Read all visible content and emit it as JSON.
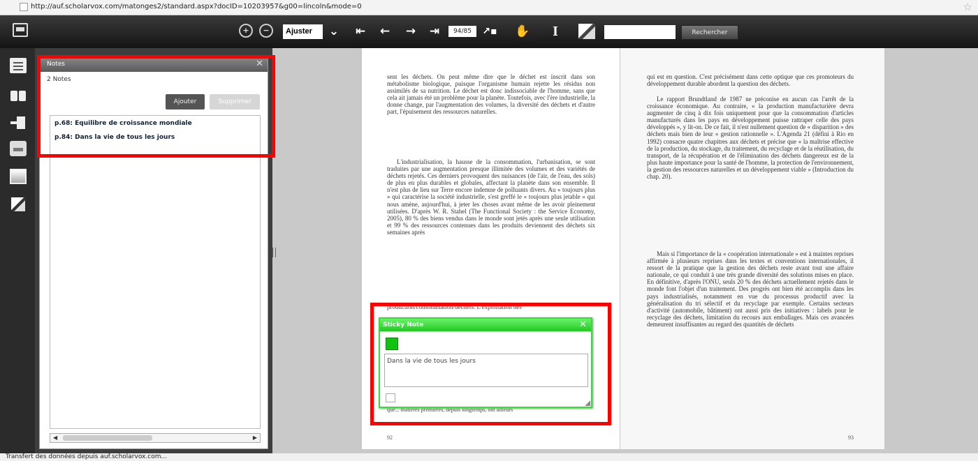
{
  "browser": {
    "url": "http://auf.scholarvox.com/matonges2/standard.aspx?docID=10203957&g00=lincoln&mode=0",
    "status": "Transfert des données depuis auf.scholarvox.com..."
  },
  "toolbar": {
    "zoom_mode": "Ajuster",
    "page_indicator": "94/85",
    "search_value": "",
    "search_button": "Rechercher",
    "icons": [
      "menu-icon",
      "zoom-in-icon",
      "zoom-out-icon",
      "dropdown-chevron-icon",
      "first-page-icon",
      "prev-page-icon",
      "next-page-icon",
      "last-page-icon",
      "go-page-icon",
      "hand-tool-icon",
      "text-select-icon",
      "highlighter-icon"
    ]
  },
  "sidebar": {
    "items": [
      "document-icon",
      "binoculars-icon",
      "exit-icon",
      "print-icon",
      "screen-icon",
      "highlighter-icon"
    ]
  },
  "notes_panel": {
    "title": "Notes",
    "count": "2 Notes",
    "add_button": "Ajouter",
    "delete_button": "Supprimer",
    "notes": [
      {
        "text": "p.68: Equilibre de croissance mondiale"
      },
      {
        "text": "p.84: Dans la vie de tous les jours"
      }
    ]
  },
  "book": {
    "left_page": {
      "number": "92",
      "paragraphs": [
        "sent les déchets. On peut même dire que le déchet est inscrit dans son métabolisme biologique, puisque l'organisme humain rejette les résidus non assimilés de sa nutrition. Le déchet est donc indissociable de l'homme, sans que cela ait jamais été un problème pour la planète. Toutefois, avec l'ère industrielle, la donne change, par l'augmentation des volumes, la diversité des déchets et d'autre part, l'épuisement des ressources naturelles.",
        "L'industrialisation, la hausse de la consommation, l'urbanisation, se sont traduites par une augmentation presque illimitée des volumes et des variétés de déchets rejetés. Ces derniers provoquent des nuisances (de l'air, de l'eau, des sols) de plus en plus durables et globales, affectant la planète dans son ensemble. Il n'est plus de lieu sur Terre encore indemne de polluants divers. Au « toujours plus » qui caractérise la société industrielle, s'est greffé le « toujours plus jetable » qui nous amène, aujourd'hui, à jeter les choses avant même de les avoir pleinement utilisées. D'après W. R. Stahel (The Functional Society : the Service Economy, 2005), 80 % des biens vendus dans le monde sont jetés après une seule utilisation et 99 % des ressources contenues dans les produits deviennent des déchets six semaines après"
      ],
      "obscured_line": "production/consommation/déchets. L'exploitation des",
      "bottom_line": "que... matières premières, depuis longtemps, ont ailleurs"
    },
    "right_page": {
      "number": "93",
      "paragraphs": [
        "qui est en question. C'est précisément dans cette optique que ces promoteurs du développement durable abordent la question des déchets.",
        "Le rapport Brundtland de 1987 ne préconise en aucun cas l'arrêt de la croissance économique. Au contraire, « la production manufacturière devra augmenter de cinq à dix fois uniquement pour que la consommation d'articles manufacturés dans les pays en développement puisse rattraper celle des pays développés », y lit-on. De ce fait, il n'est nullement question de « disparition » des déchets mais bien de leur « gestion rationnelle ». L'Agenda 21 (défini à Rio en 1992) consacre quatre chapitres aux déchets et précise que « la maîtrise effective de la production, du stockage, du traitement, du recyclage et de la réutilisation, du transport, de la récupération et de l'élimination des déchets dangereux est de la plus haute importance pour la santé de l'homme, la protection de l'environnement, la gestion des ressources naturelles et un développement viable » (Introduction du chap. 20).",
        "Mais si l'importance de la « coopération internationale » est à maintes reprises affirmée à plusieurs reprises dans les textes et conventions internationales, il ressort de la pratique que la gestion des déchets reste avant tout une affaire nationale, ce qui conduit à une très grande diversité des solutions mises en place. En définitive, d'après l'ONU, seuls 20 % des déchets actuellement rejetés dans le monde font l'objet d'un traitement. Des progrès ont bien été accomplis dans les pays industrialisés, notamment en vue du processus productif avec la généralisation du tri sélectif et du recyclage par exemple. Certains secteurs d'activité (automobile, bâtiment) ont aussi pris des initiatives : labels pour le recyclage des déchets, limitation du recours aux emballages. Mais ces avancées demeurent insuffisantes au regard des quantités de déchets"
      ]
    }
  },
  "sticky_note": {
    "title": "Sticky Note",
    "text": "Dans la vie de tous les jours",
    "color": "#11c311"
  },
  "colors": {
    "highlight_box": "#ff0000",
    "sticky_accent": "#2ee42e"
  }
}
